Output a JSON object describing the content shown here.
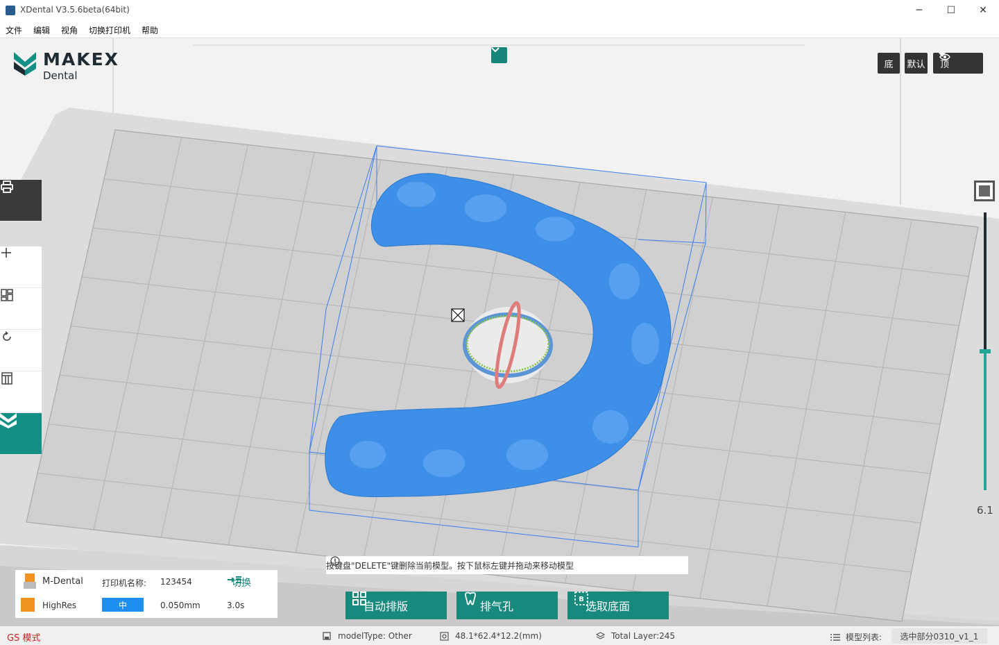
{
  "window": {
    "title": "XDental V3.5.6beta(64bit)",
    "minimize": "─",
    "maximize": "☐",
    "close": "✕"
  },
  "menu": [
    "文件",
    "编辑",
    "视角",
    "切换打印机",
    "帮助"
  ],
  "logo": {
    "brand": "MAKEX",
    "sub": "Dental"
  },
  "view_buttons": {
    "bottom": "底",
    "default": "默认",
    "top": "顶"
  },
  "slider": {
    "value_label": "6.1",
    "fill_fraction": 0.5
  },
  "hint": "按键盘\"DELETE\"键删除当前模型。按下鼠标左键并拖动来移动模型",
  "info": {
    "brand": "M-Dental",
    "printer_name_label": "打印机名称:",
    "printer_name_value": "123454",
    "switch_label": "切换",
    "material": "HighRes",
    "quality": "中",
    "layer_thickness": "0.050mm",
    "exposure": "3.0s"
  },
  "actions": {
    "auto_layout": "自动排版",
    "vent_hole": "排气孔",
    "select_base": "选取底面"
  },
  "status": {
    "mode": "GS 模式",
    "model_type": "modelType: Other",
    "dimensions": "48.1*62.4*12.2(mm)",
    "total_layer": "Total Layer:245",
    "model_list_label": "模型列表:",
    "selected_model": "选中部分0310_v1_1"
  },
  "colors": {
    "accent": "#17897d",
    "model": "#3d8fe8",
    "status_mode": "#d32020",
    "quality_bar": "#1e8ff0"
  }
}
